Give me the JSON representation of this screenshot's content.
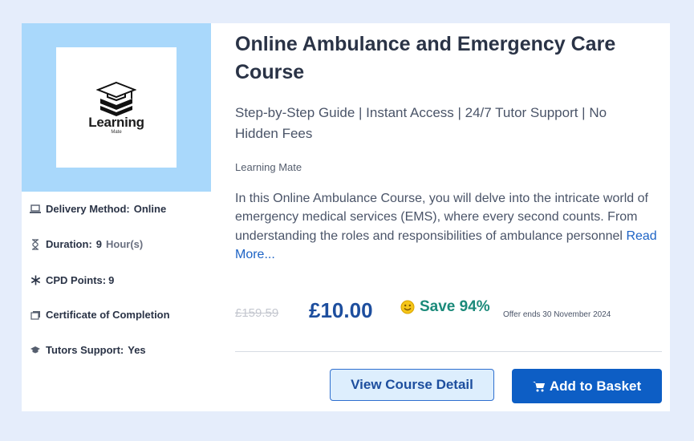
{
  "course": {
    "logo_text": "Learning",
    "logo_sub": "Mate",
    "title": "Online Ambulance and Emergency Care Course",
    "subtitle": "Step-by-Step Guide | Instant Access | 24/7 Tutor Support | No Hidden Fees",
    "provider": "Learning Mate",
    "description": "In this Online Ambulance Course, you will delve into the intricate world of emergency medical services (EMS), where every second counts. From understanding the roles and responsibilities of ambulance personnel",
    "read_more": "Read More..."
  },
  "meta": {
    "delivery_label": "Delivery Method:",
    "delivery_value": "Online",
    "duration_label": "Duration:",
    "duration_value": "9",
    "duration_unit": "Hour(s)",
    "cpd_label": "CPD Points:",
    "cpd_value": "9",
    "certificate_label": "Certificate of Completion",
    "tutors_label": "Tutors Support:",
    "tutors_value": "Yes"
  },
  "pricing": {
    "old_price": "£159.59",
    "price": "£10.00",
    "save": "Save 94%",
    "offer": "Offer ends 30 November 2024"
  },
  "buttons": {
    "view_detail": "View Course Detail",
    "add_basket": "Add to Basket"
  },
  "icons": [
    "laptop-icon",
    "hourglass-icon",
    "asterisk-icon",
    "certificate-icon",
    "graduation-cap-icon",
    "smile-icon",
    "cart-icon"
  ],
  "colors": {
    "accent": "#0d5ec5",
    "price": "#1d4e9e",
    "save": "#1b8a7a",
    "thumb_bg": "#a9d8fb",
    "page_bg": "#e5edfb"
  }
}
